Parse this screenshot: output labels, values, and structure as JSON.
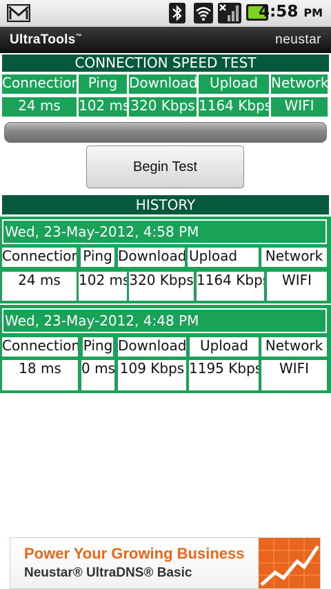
{
  "status_bar": {
    "time": "4:58",
    "ampm": "PM"
  },
  "header": {
    "app_title": "UltraTools",
    "trademark": "™",
    "brand": "neustar"
  },
  "speed_test": {
    "title": "CONNECTION SPEED TEST",
    "columns": [
      "Connection",
      "Ping",
      "Download",
      "Upload",
      "Network"
    ],
    "values": [
      "24 ms",
      "102 ms",
      "320 Kbps",
      "1164 Kbps",
      "WIFI"
    ],
    "progress": 0,
    "button_label": "Begin Test"
  },
  "history": {
    "title": "HISTORY",
    "entries": [
      {
        "date": "Wed, 23-May-2012, 4:58 PM",
        "columns": [
          "Connection",
          "Ping",
          "Download",
          "Upload",
          "Network"
        ],
        "values": [
          "24 ms",
          "102 ms",
          "320 Kbps",
          "1164 Kbps",
          "WIFI"
        ]
      },
      {
        "date": "Wed, 23-May-2012, 4:48 PM",
        "columns": [
          "Connection",
          "Ping",
          "Download",
          "Upload",
          "Network"
        ],
        "values": [
          "18 ms",
          "0 ms",
          "109 Kbps",
          "1195 Kbps",
          "WIFI"
        ]
      }
    ]
  },
  "ad": {
    "line1": "Power Your Growing Business",
    "line2": "Neustar® UltraDNS® Basic"
  },
  "colors": {
    "dark_green": "#07593b",
    "green": "#1aa358",
    "ad_orange": "#e8671a"
  }
}
